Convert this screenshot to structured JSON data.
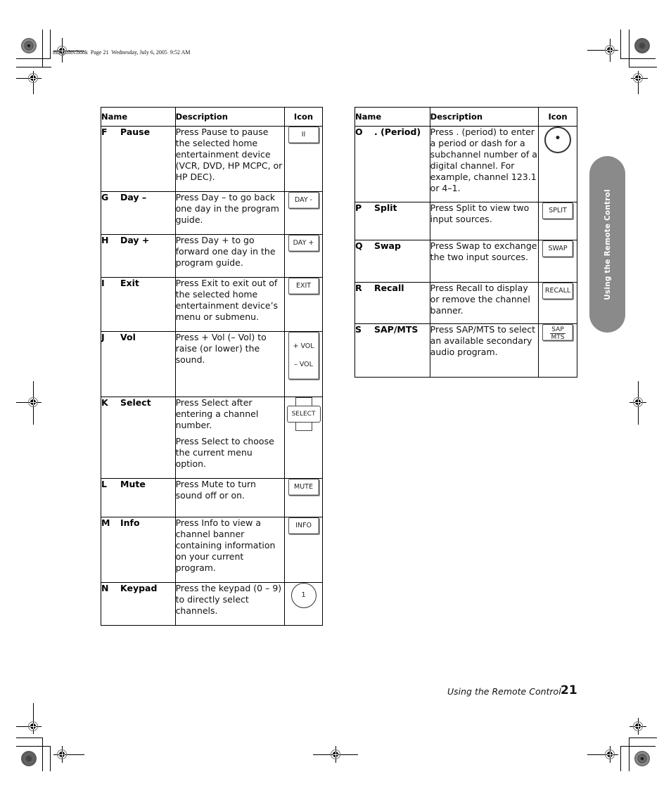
{
  "print_header": "mb5pohtv.book  Page 21  Wednesday, July 6, 2005  9:52 AM",
  "side_tab": "Using the Remote Control",
  "footer": {
    "title": "Using the Remote Control",
    "page_number": "21"
  },
  "columns": {
    "name": "Name",
    "description": "Description",
    "icon": "Icon"
  },
  "left_table": [
    {
      "letter": "F",
      "name": "Pause",
      "description": [
        "Press Pause to pause the selected home entertainment device (VCR, DVD, HP MCPC, or HP DEC)."
      ],
      "icon": {
        "type": "button",
        "label": "II",
        "semantic": "pause-icon"
      }
    },
    {
      "letter": "G",
      "name": "Day –",
      "description": [
        "Press Day – to go back one day in the program guide."
      ],
      "icon": {
        "type": "button",
        "label": "DAY -",
        "semantic": "day-minus-icon"
      }
    },
    {
      "letter": "H",
      "name": "Day +",
      "description": [
        "Press Day + to go forward one day in the program guide."
      ],
      "icon": {
        "type": "button",
        "label": "DAY +",
        "semantic": "day-plus-icon"
      }
    },
    {
      "letter": "I",
      "name": "Exit",
      "description": [
        "Press Exit to exit out of the selected home entertainment device’s menu or submenu."
      ],
      "icon": {
        "type": "button",
        "label": "EXIT",
        "semantic": "exit-icon"
      }
    },
    {
      "letter": "J",
      "name": "Vol",
      "description": [
        "Press + Vol (– Vol) to raise (or lower) the sound."
      ],
      "icon": {
        "type": "rocker",
        "label_top": "+ VOL",
        "label_bottom": "– VOL",
        "semantic": "volume-rocker-icon"
      }
    },
    {
      "letter": "K",
      "name": "Select",
      "description": [
        "Press Select after entering a channel number.",
        "Press Select to choose the current menu option."
      ],
      "icon": {
        "type": "dpad",
        "label": "SELECT",
        "semantic": "select-dpad-icon"
      }
    },
    {
      "letter": "L",
      "name": "Mute",
      "description": [
        "Press Mute to turn sound off or on."
      ],
      "icon": {
        "type": "button",
        "label": "MUTE",
        "semantic": "mute-icon"
      }
    },
    {
      "letter": "M",
      "name": "Info",
      "description": [
        "Press Info to view a channel banner containing information on your current program."
      ],
      "icon": {
        "type": "button",
        "label": "INFO",
        "semantic": "info-icon"
      }
    },
    {
      "letter": "N",
      "name": "Keypad",
      "description": [
        "Press the keypad (0 – 9) to directly select channels."
      ],
      "icon": {
        "type": "circle",
        "label": "1",
        "semantic": "keypad-number-icon"
      }
    }
  ],
  "right_table": [
    {
      "letter": "O",
      "name": ". (Period)",
      "description": [
        "Press . (period) to enter a period or dash for a subchannel number of a digital channel. For example, channel 123.1 or 4–1."
      ],
      "icon": {
        "type": "circle-period",
        "label": "•",
        "semantic": "period-icon"
      }
    },
    {
      "letter": "P",
      "name": "Split",
      "description": [
        "Press Split to view two input sources."
      ],
      "icon": {
        "type": "button",
        "label": "SPLIT",
        "semantic": "split-icon"
      }
    },
    {
      "letter": "Q",
      "name": "Swap",
      "description": [
        "Press Swap to exchange the two input sources."
      ],
      "icon": {
        "type": "button",
        "label": "SWAP",
        "semantic": "swap-icon"
      }
    },
    {
      "letter": "R",
      "name": "Recall",
      "description": [
        "Press Recall to display or remove the channel banner."
      ],
      "icon": {
        "type": "button",
        "label": "RECALL",
        "semantic": "recall-icon"
      }
    },
    {
      "letter": "S",
      "name": "SAP/MTS",
      "description": [
        "Press SAP/MTS to select an available secondary audio program."
      ],
      "icon": {
        "type": "sap",
        "label_top": "SAP",
        "label_bottom": "MTS",
        "semantic": "sap-mts-icon"
      }
    }
  ]
}
